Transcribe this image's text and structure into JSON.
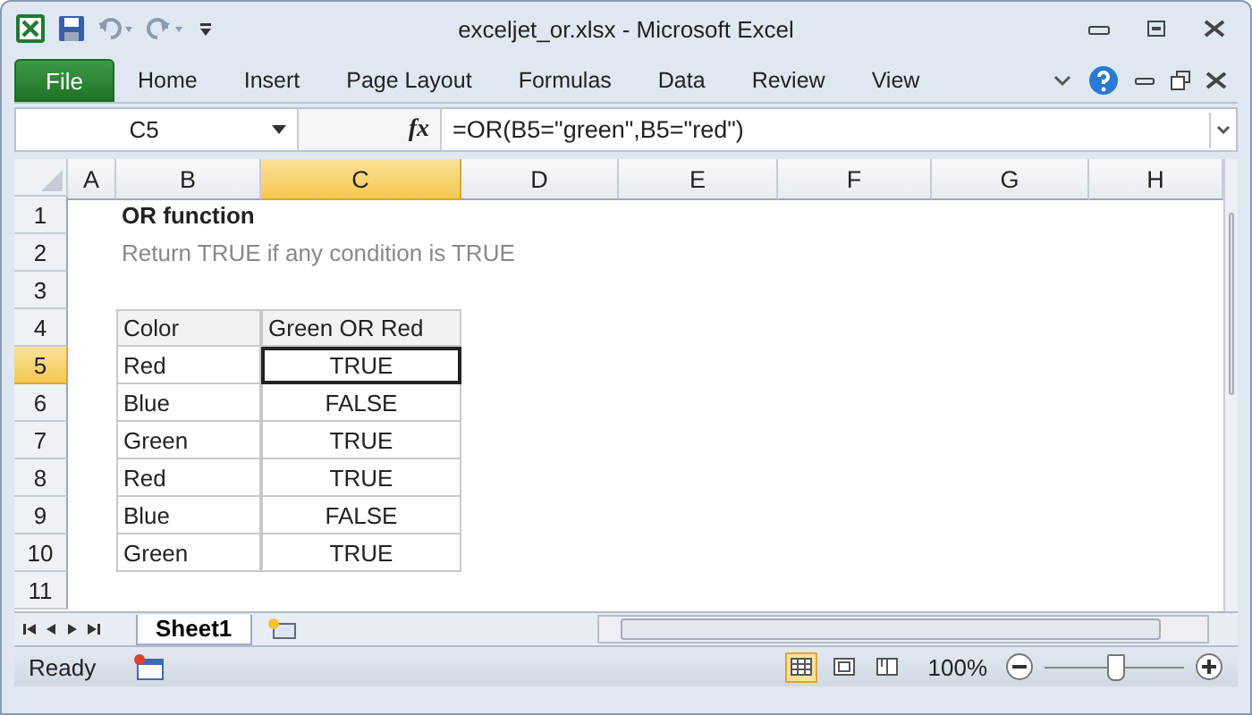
{
  "window": {
    "title": "exceljet_or.xlsx - Microsoft Excel"
  },
  "ribbon_tabs": [
    {
      "label": "File",
      "kind": "file"
    },
    {
      "label": "Home",
      "kind": "tab"
    },
    {
      "label": "Insert",
      "kind": "tab"
    },
    {
      "label": "Page Layout",
      "kind": "tab"
    },
    {
      "label": "Formulas",
      "kind": "tab"
    },
    {
      "label": "Data",
      "kind": "tab"
    },
    {
      "label": "Review",
      "kind": "tab"
    },
    {
      "label": "View",
      "kind": "tab"
    }
  ],
  "formula_bar": {
    "name_box": "C5",
    "fx": "fx",
    "formula": "=OR(B5=\"green\",B5=\"red\")"
  },
  "columns": [
    {
      "label": "A",
      "selected": false
    },
    {
      "label": "B",
      "selected": false
    },
    {
      "label": "C",
      "selected": true
    },
    {
      "label": "D",
      "selected": false
    },
    {
      "label": "E",
      "selected": false
    },
    {
      "label": "F",
      "selected": false
    },
    {
      "label": "G",
      "selected": false
    },
    {
      "label": "H",
      "selected": false
    }
  ],
  "rows": [
    {
      "number": "1",
      "selected": false,
      "kind": "title",
      "b": "OR function"
    },
    {
      "number": "2",
      "selected": false,
      "kind": "subtitle",
      "b": "Return TRUE if any condition is TRUE"
    },
    {
      "number": "3",
      "selected": false,
      "kind": "empty"
    },
    {
      "number": "4",
      "selected": false,
      "kind": "header",
      "b": "Color",
      "c": "Green OR Red"
    },
    {
      "number": "5",
      "selected": true,
      "kind": "data",
      "b": "Red",
      "c": "TRUE"
    },
    {
      "number": "6",
      "selected": false,
      "kind": "data",
      "b": "Blue",
      "c": "FALSE"
    },
    {
      "number": "7",
      "selected": false,
      "kind": "data",
      "b": "Green",
      "c": "TRUE"
    },
    {
      "number": "8",
      "selected": false,
      "kind": "data",
      "b": "Red",
      "c": "TRUE"
    },
    {
      "number": "9",
      "selected": false,
      "kind": "data",
      "b": "Blue",
      "c": "FALSE"
    },
    {
      "number": "10",
      "selected": false,
      "kind": "data",
      "b": "Green",
      "c": "TRUE"
    },
    {
      "number": "11",
      "selected": false,
      "kind": "empty"
    }
  ],
  "sheet_tabs": [
    {
      "label": "Sheet1",
      "selected": true
    }
  ],
  "status_bar": {
    "status": "Ready",
    "views": [
      {
        "kind": "normal",
        "selected": true
      },
      {
        "kind": "layout",
        "selected": false
      },
      {
        "kind": "pagebreak",
        "selected": false
      }
    ],
    "zoom": "100%",
    "zoom_slider": {
      "level": 0.5
    }
  }
}
